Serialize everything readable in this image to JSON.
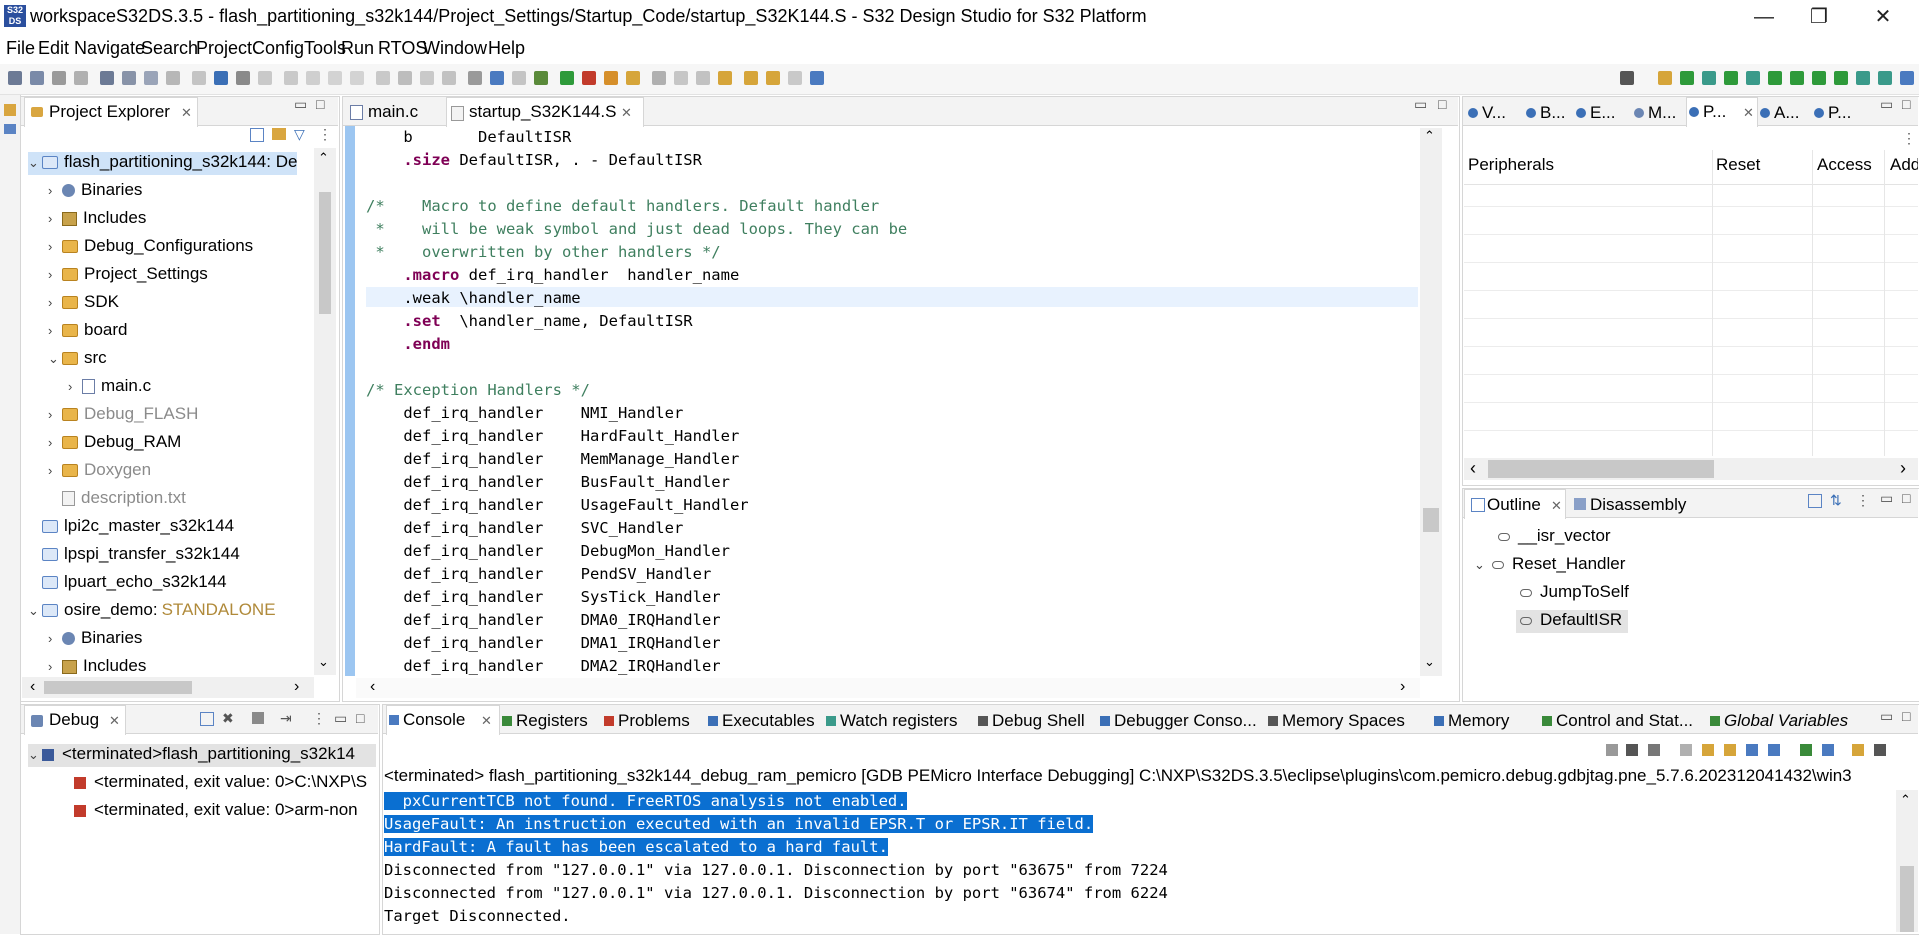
{
  "window": {
    "title": "workspaceS32DS.3.5 - flash_partitioning_s32k144/Project_Settings/Startup_Code/startup_S32K144.S - S32 Design Studio for S32 Platform",
    "icon_text": "S32\nDS",
    "minimize_glyph": "—",
    "restore_glyph": "❐",
    "close_glyph": "✕"
  },
  "menu": [
    "File",
    "Edit",
    "Navigate",
    "Search",
    "Project",
    "ConfigTools",
    "Run",
    "RTOS",
    "Window",
    "Help"
  ],
  "project_explorer": {
    "tab_label": "Project Explorer",
    "items": [
      {
        "label": "flash_partitioning_s32k144: De",
        "twisty": "⌄",
        "icon": "project-icon",
        "selected": true
      },
      {
        "label": "Binaries",
        "twisty": "›",
        "icon": "binaries-icon"
      },
      {
        "label": "Includes",
        "twisty": "›",
        "icon": "includes-icon"
      },
      {
        "label": "Debug_Configurations",
        "twisty": "›",
        "icon": "folder-icon"
      },
      {
        "label": "Project_Settings",
        "twisty": "›",
        "icon": "folder-icon"
      },
      {
        "label": "SDK",
        "twisty": "›",
        "icon": "folder-icon"
      },
      {
        "label": "board",
        "twisty": "›",
        "icon": "folder-icon"
      },
      {
        "label": "src",
        "twisty": "⌄",
        "icon": "folder-icon"
      },
      {
        "label": "main.c",
        "twisty": "›",
        "icon": "c-file-icon"
      },
      {
        "label": "Debug_FLASH",
        "twisty": "›",
        "icon": "folder-icon",
        "grey": true
      },
      {
        "label": "Debug_RAM",
        "twisty": "›",
        "icon": "folder-icon"
      },
      {
        "label": "Doxygen",
        "twisty": "›",
        "icon": "folder-icon",
        "grey": true
      },
      {
        "label": "description.txt",
        "twisty": "",
        "icon": "text-file-icon",
        "grey": true
      },
      {
        "label": "lpi2c_master_s32k144",
        "twisty": "",
        "icon": "project-icon"
      },
      {
        "label": "lpspi_transfer_s32k144",
        "twisty": "",
        "icon": "project-icon"
      },
      {
        "label": "lpuart_echo_s32k144",
        "twisty": "",
        "icon": "project-icon"
      },
      {
        "label": "osire_demo:",
        "suffix": "STANDALONE",
        "twisty": "⌄",
        "icon": "project-icon"
      },
      {
        "label": "Binaries",
        "twisty": "›",
        "icon": "binaries-icon"
      },
      {
        "label": "Includes",
        "twisty": "›",
        "icon": "includes-icon"
      }
    ]
  },
  "editor": {
    "tabs": [
      {
        "label": "main.c",
        "active": false
      },
      {
        "label": "startup_S32K144.S",
        "active": true
      }
    ],
    "lines": [
      [
        {
          "t": "    b       DefaultISR",
          "c": ""
        }
      ],
      [
        {
          "t": "    ",
          "c": ""
        },
        {
          "t": ".size",
          "c": "kw"
        },
        {
          "t": " DefaultISR, . - DefaultISR",
          "c": ""
        }
      ],
      [
        {
          "t": "",
          "c": ""
        }
      ],
      [
        {
          "t": "/*    Macro to define default handlers. Default handler",
          "c": "cm"
        }
      ],
      [
        {
          "t": " *    will be weak symbol and just dead loops. They can be",
          "c": "cm"
        }
      ],
      [
        {
          "t": " *    overwritten by other handlers */",
          "c": "cm"
        }
      ],
      [
        {
          "t": "    ",
          "c": ""
        },
        {
          "t": ".macro",
          "c": "kw"
        },
        {
          "t": " def_irq_handler  handler_name",
          "c": ""
        }
      ],
      [
        {
          "t": "    .weak \\handler_name",
          "c": ""
        }
      ],
      [
        {
          "t": "    ",
          "c": ""
        },
        {
          "t": ".set",
          "c": "kw"
        },
        {
          "t": "  \\handler_name, DefaultISR",
          "c": ""
        }
      ],
      [
        {
          "t": "    ",
          "c": ""
        },
        {
          "t": ".endm",
          "c": "kw"
        }
      ],
      [
        {
          "t": "",
          "c": ""
        }
      ],
      [
        {
          "t": "/* Exception Handlers */",
          "c": "cm"
        }
      ],
      [
        {
          "t": "    def_irq_handler    NMI_Handler",
          "c": ""
        }
      ],
      [
        {
          "t": "    def_irq_handler    HardFault_Handler",
          "c": ""
        }
      ],
      [
        {
          "t": "    def_irq_handler    MemManage_Handler",
          "c": ""
        }
      ],
      [
        {
          "t": "    def_irq_handler    BusFault_Handler",
          "c": ""
        }
      ],
      [
        {
          "t": "    def_irq_handler    UsageFault_Handler",
          "c": ""
        }
      ],
      [
        {
          "t": "    def_irq_handler    SVC_Handler",
          "c": ""
        }
      ],
      [
        {
          "t": "    def_irq_handler    DebugMon_Handler",
          "c": ""
        }
      ],
      [
        {
          "t": "    def_irq_handler    PendSV_Handler",
          "c": ""
        }
      ],
      [
        {
          "t": "    def_irq_handler    SysTick_Handler",
          "c": ""
        }
      ],
      [
        {
          "t": "    def_irq_handler    DMA0_IRQHandler",
          "c": ""
        }
      ],
      [
        {
          "t": "    def_irq_handler    DMA1_IRQHandler",
          "c": ""
        }
      ],
      [
        {
          "t": "    def_irq_handler    DMA2_IRQHandler",
          "c": ""
        }
      ]
    ]
  },
  "right_top": {
    "tabs": [
      "V...",
      "B...",
      "E...",
      "M...",
      "P...",
      "A...",
      "P..."
    ],
    "active_tab_index": 4,
    "columns": [
      "Peripherals",
      "Reset",
      "Access",
      "Add"
    ]
  },
  "outline": {
    "tabs": [
      "Outline",
      "Disassembly"
    ],
    "items": [
      {
        "label": "__isr_vector",
        "indent": 1,
        "twisty": ""
      },
      {
        "label": "Reset_Handler",
        "indent": 0,
        "twisty": "⌄"
      },
      {
        "label": "JumpToSelf",
        "indent": 2,
        "twisty": ""
      },
      {
        "label": "DefaultISR",
        "indent": 2,
        "twisty": "",
        "selected": true
      }
    ]
  },
  "debug": {
    "tab_label": "Debug",
    "items": [
      {
        "label": "<terminated>flash_partitioning_s32k14",
        "indent": 0,
        "twisty": "⌄"
      },
      {
        "label": "<terminated, exit value: 0>C:\\NXP\\S",
        "indent": 1,
        "twisty": ""
      },
      {
        "label": "<terminated, exit value: 0>arm-non",
        "indent": 1,
        "twisty": ""
      }
    ]
  },
  "console": {
    "tabs": [
      "Console",
      "Registers",
      "Problems",
      "Executables",
      "Watch registers",
      "Debug Shell",
      "Debugger Conso...",
      "Memory Spaces",
      "Memory",
      "Control and Stat...",
      "Global Variables"
    ],
    "header": "<terminated> flash_partitioning_s32k144_debug_ram_pemicro [GDB PEMicro Interface Debugging] C:\\NXP\\S32DS.3.5\\eclipse\\plugins\\com.pemicro.debug.gdbjtag.pne_5.7.6.202312041432\\win3",
    "lines": [
      {
        "text": "  pxCurrentTCB not found. FreeRTOS analysis not enabled.",
        "selected": true
      },
      {
        "text": "UsageFault: An instruction executed with an invalid EPSR.T or EPSR.IT field.",
        "selected": true
      },
      {
        "text": "HardFault: A fault has been escalated to a hard fault.",
        "selected": true
      },
      {
        "text": "Disconnected from \"127.0.0.1\" via 127.0.0.1. Disconnection by port \"63675\" from 7224",
        "selected": false
      },
      {
        "text": "Disconnected from \"127.0.0.1\" via 127.0.0.1. Disconnection by port \"63674\" from 6224",
        "selected": false
      },
      {
        "text": "Target Disconnected.",
        "selected": false
      }
    ]
  },
  "colors": {
    "selection": "#0a6fd1",
    "keyword": "#7f0055",
    "comment": "#3f7f5f",
    "highlight_line": "#e8f2fe"
  }
}
